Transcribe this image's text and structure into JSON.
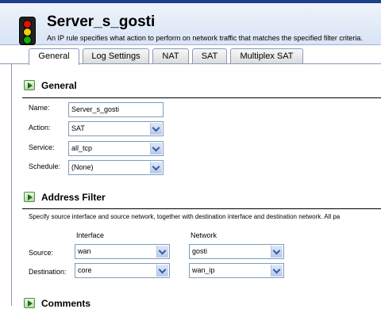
{
  "header": {
    "title": "Server_s_gosti",
    "subtitle": "An IP rule specifies what action to perform on network traffic that matches the specified filter criteria."
  },
  "tabs": [
    {
      "label": "General",
      "active": true
    },
    {
      "label": "Log Settings"
    },
    {
      "label": "NAT"
    },
    {
      "label": "SAT"
    },
    {
      "label": "Multiplex SAT"
    }
  ],
  "general": {
    "title": "General",
    "name_label": "Name:",
    "name_value": "Server_s_gosti",
    "action_label": "Action:",
    "action_value": "SAT",
    "service_label": "Service:",
    "service_value": "all_tcp",
    "schedule_label": "Schedule:",
    "schedule_value": "(None)"
  },
  "address_filter": {
    "title": "Address Filter",
    "description": "Specify source interface and source network, together with destination interface and destination network. All pa",
    "col_interface": "Interface",
    "col_network": "Network",
    "source_label": "Source:",
    "source_interface": "wan",
    "source_network": "gosti",
    "destination_label": "Destination:",
    "destination_interface": "core",
    "destination_network": "wan_ip"
  },
  "comments": {
    "title": "Comments"
  },
  "colors": {
    "topbar": "#1c3f8e",
    "header_bg": "#d9e4f5",
    "field_border": "#7f9db9"
  }
}
